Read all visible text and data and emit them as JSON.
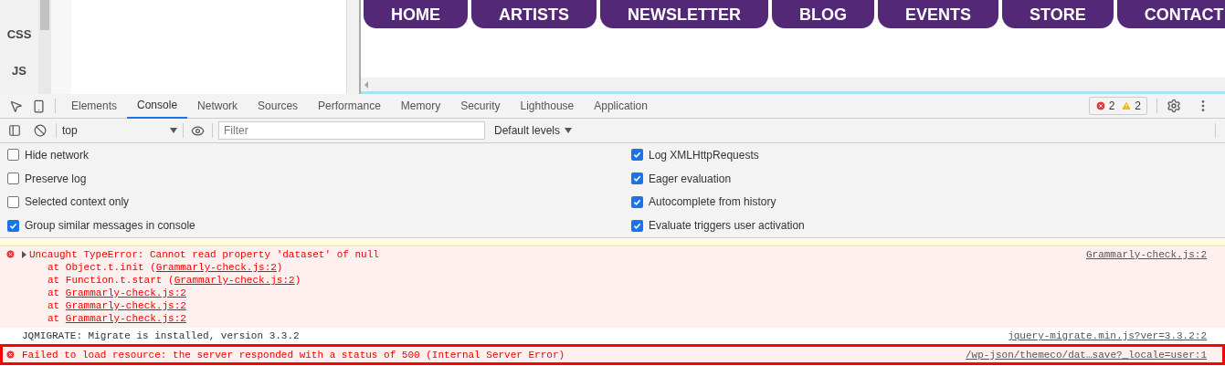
{
  "editor_sidebar": {
    "items": [
      "CSS",
      "JS"
    ]
  },
  "site_nav": [
    "HOME",
    "ARTISTS",
    "NEWSLETTER",
    "BLOG",
    "EVENTS",
    "STORE",
    "CONTACT"
  ],
  "devtools_tabs": [
    {
      "label": "Elements",
      "selected": false
    },
    {
      "label": "Console",
      "selected": true
    },
    {
      "label": "Network",
      "selected": false
    },
    {
      "label": "Sources",
      "selected": false
    },
    {
      "label": "Performance",
      "selected": false
    },
    {
      "label": "Memory",
      "selected": false
    },
    {
      "label": "Security",
      "selected": false
    },
    {
      "label": "Lighthouse",
      "selected": false
    },
    {
      "label": "Application",
      "selected": false
    }
  ],
  "issue_counts": {
    "errors": "2",
    "warnings": "2"
  },
  "console_toolbar": {
    "context": "top",
    "filter_placeholder": "Filter",
    "levels": "Default levels"
  },
  "settings_left": [
    {
      "label": "Hide network",
      "checked": false
    },
    {
      "label": "Preserve log",
      "checked": false
    },
    {
      "label": "Selected context only",
      "checked": false
    },
    {
      "label": "Group similar messages in console",
      "checked": true
    }
  ],
  "settings_right": [
    {
      "label": "Log XMLHttpRequests",
      "checked": true
    },
    {
      "label": "Eager evaluation",
      "checked": true
    },
    {
      "label": "Autocomplete from history",
      "checked": true
    },
    {
      "label": "Evaluate triggers user activation",
      "checked": true
    }
  ],
  "messages": [
    {
      "kind": "error",
      "text": "Uncaught TypeError: Cannot read property 'dataset' of null",
      "source": "Grammarly-check.js:2",
      "expandable": true,
      "highlighted": false,
      "stack": [
        {
          "text": "at Object.t.init (",
          "link": "Grammarly-check.js:2",
          "tail": ")"
        },
        {
          "text": "at Function.t.start (",
          "link": "Grammarly-check.js:2",
          "tail": ")"
        },
        {
          "text": "at ",
          "link": "Grammarly-check.js:2"
        },
        {
          "text": "at ",
          "link": "Grammarly-check.js:2"
        },
        {
          "text": "at ",
          "link": "Grammarly-check.js:2"
        }
      ]
    },
    {
      "kind": "log",
      "text": "JQMIGRATE: Migrate is installed, version 3.3.2",
      "source": "jquery-migrate.min.js?ver=3.3.2:2",
      "expandable": false,
      "highlighted": false
    },
    {
      "kind": "error",
      "text": "Failed to load resource: the server responded with a status of 500 (Internal Server Error)",
      "source": "/wp-json/themeco/dat…save?_locale=user:1",
      "expandable": false,
      "highlighted": true
    }
  ]
}
